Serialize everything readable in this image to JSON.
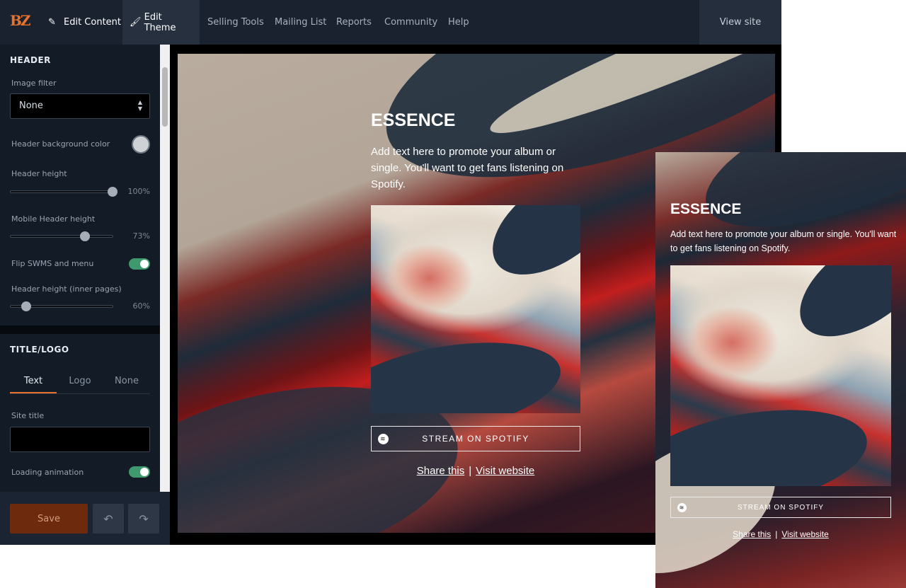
{
  "nav": {
    "logo": "BZ",
    "edit_content": "Edit Content",
    "edit_theme": "Edit Theme",
    "selling_tools": "Selling Tools",
    "mailing_list": "Mailing List",
    "reports": "Reports",
    "community": "Community",
    "help": "Help",
    "view_site": "View site"
  },
  "sidebar": {
    "header": {
      "title": "HEADER",
      "image_filter_label": "Image filter",
      "image_filter_value": "None",
      "bg_color_label": "Header background color",
      "bg_color": "#cfd2d5",
      "height_label": "Header height",
      "height_value": "100%",
      "height_fraction": 1.0,
      "mobile_height_label": "Mobile Header height",
      "mobile_height_value": "73%",
      "mobile_height_fraction": 0.73,
      "flip_label": "Flip SWMS and menu",
      "flip_on": true,
      "inner_height_label": "Header height (inner pages)",
      "inner_height_value": "60%",
      "inner_height_fraction": 0.15
    },
    "title_logo": {
      "title": "TITLE/LOGO",
      "tabs": [
        "Text",
        "Logo",
        "None"
      ],
      "active_tab": "Text",
      "site_title_label": "Site title",
      "site_title_value": "",
      "loading_label": "Loading animation",
      "loading_on": true
    },
    "footer": {
      "save": "Save",
      "undo_icon": "↶",
      "redo_icon": "↷"
    }
  },
  "preview": {
    "title": "ESSENCE",
    "description": "Add text here to promote your album or single. You'll want to get fans listening on Spotify.",
    "stream_label": "STREAM ON SPOTIFY",
    "share": "Share this",
    "separator": "|",
    "visit": "Visit website"
  },
  "mobile": {
    "title": "ESSENCE",
    "description": "Add text here to promote your album or single. You'll want to get fans listening on Spotify.",
    "stream_label": "STREAM ON SPOTIFY",
    "share": "Share this",
    "separator": "|",
    "visit": "Visit website"
  },
  "colors": {
    "accent": "#e8732c",
    "toggle_on": "#3e9a6e",
    "topbar": "#1a2230"
  }
}
